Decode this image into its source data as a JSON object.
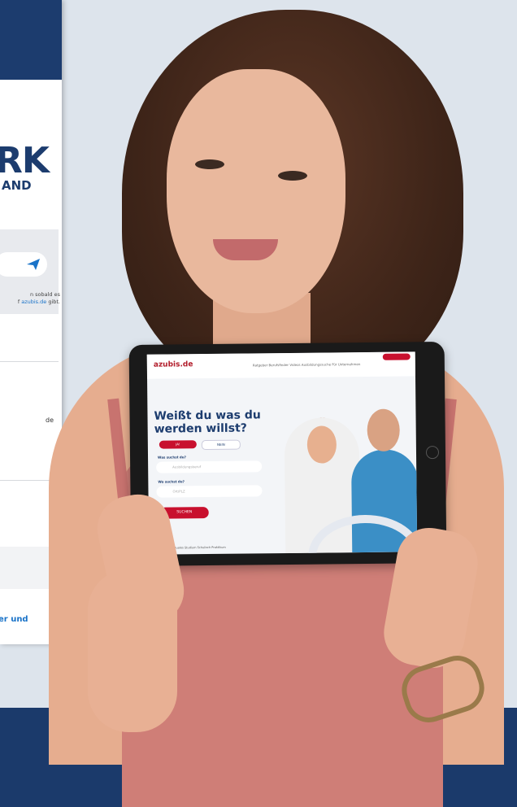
{
  "background_page": {
    "brand_big": "RK",
    "brand_small": "AND",
    "newsletter_note_line1": "n sobald es",
    "newsletter_note_line2_prefix": "f ",
    "newsletter_note_link": "azubis.de",
    "newsletter_note_line2_suffix": " gibt.",
    "fragment_text": "de",
    "bottom_link": "er und"
  },
  "tablet_screen": {
    "logo": "azubis.de",
    "nav_links": "Ratgeber   Berufsfinder   Videos   Ausbildungssuche   Für Unternehmen",
    "heading": "Weißt du was du werden willst?",
    "toggle_yes": "JA!",
    "toggle_no": "NEIN",
    "label_what": "Was suchst du?",
    "input_what_placeholder": "Ausbildungsberuf",
    "label_where": "Wo suchst du?",
    "input_where_placeholder": "Ort/PLZ",
    "search_button": "SUCHEN",
    "tabs": "Ausbildung        Duales Studium        Schulisch        Praktikum"
  },
  "colors": {
    "navy": "#1c3c6e",
    "accent_red": "#c8102e",
    "link_blue": "#1a73c8",
    "shirt": "#cf7e77"
  }
}
